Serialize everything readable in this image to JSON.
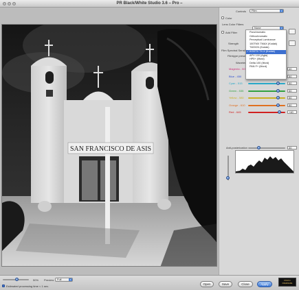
{
  "window": {
    "title": "PR Black/White Studio 3.6 – Pro –",
    "buttons": [
      "close",
      "minimize",
      "zoom"
    ]
  },
  "photo": {
    "sign_text": "SAN FRANCISCO DE ASIS",
    "description_icon": "church-photo"
  },
  "controls": {
    "label": "Controls",
    "value": "Film"
  },
  "color": {
    "label": "Color",
    "checked": false
  },
  "lens_color_filters": {
    "label": "Lens Color Filters",
    "value": "None"
  },
  "add_filter": {
    "label": "Add Filter",
    "checked": false
  },
  "strength_label": "Strength",
  "film_spectral_label": "Film Spectral Sensitivity",
  "filmtype_preset_label": "Filmtype preset",
  "wavelength_label": "Wavelength",
  "filmtype_menu": {
    "items": [
      "Panchromatic",
      "Orthochromatic",
      "Perceptual Luminance",
      "100TMX TMAX (Kodak)",
      "T400CN (Kodak)",
      "KODTX TX-X (Kodak)",
      "APX 100 (Agfa)",
      "HP5+ (Ilford)",
      "Delta 100 (Ilford)",
      "PAN F+ (Ilford)"
    ],
    "selected_index": 5
  },
  "channels": [
    {
      "name": "Magenta - 500",
      "value": "40",
      "color": "#d0307a",
      "level": 0.78
    },
    {
      "name": "Blue - 450",
      "value": "50",
      "color": "#3050d0",
      "level": 0.82
    },
    {
      "name": "Cyan - 515",
      "value": "50",
      "color": "#2aa8c8",
      "level": 0.82
    },
    {
      "name": "Green - 535",
      "value": "50",
      "color": "#30a040",
      "level": 0.82
    },
    {
      "name": "Yellow - 580",
      "value": "50",
      "color": "#c8b020",
      "level": 0.82
    },
    {
      "name": "Orange - 610",
      "value": "50",
      "color": "#e07020",
      "level": 0.82
    },
    {
      "name": "Red - 645",
      "value": "+40",
      "color": "#d02020",
      "level": 0.86
    }
  ],
  "antiposterization": {
    "label": "Anti-posterization",
    "value": "30",
    "level": 0.3
  },
  "histogram_icon": "histogram-chart",
  "zoom": {
    "value": "50%",
    "level": 0.55,
    "preview_label": "Preview",
    "preview_value": "Full"
  },
  "status": {
    "estimated_label": "Estimated processing time < 1 sec.",
    "checked": true
  },
  "footer_buttons": {
    "open": "Open",
    "save": "Save",
    "close": "Close",
    "apply": "Apply"
  },
  "logo": {
    "line1": "PHOTO",
    "line2": "FREEWARE"
  },
  "colors": {
    "accent": "#3c6fd0",
    "chrome": "#d6d6d6"
  }
}
